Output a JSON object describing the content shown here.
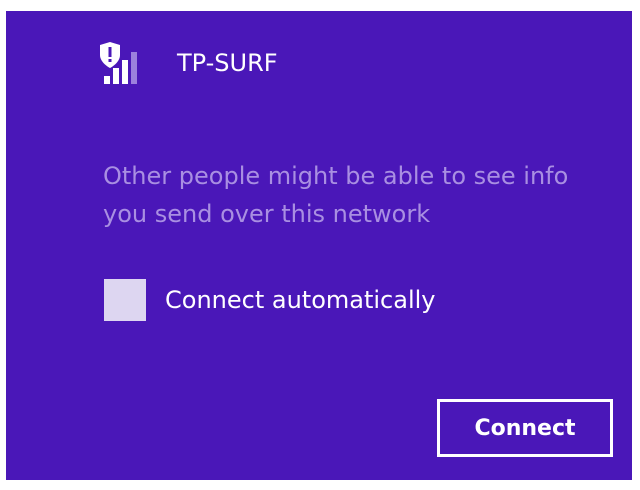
{
  "network": {
    "ssid": "TP-SURF",
    "icon": "wifi-signal-icon",
    "security_icon": "shield-warning-icon",
    "signal_bars_filled": 3,
    "signal_bars_total": 5
  },
  "warning": {
    "text": "Other people might be able to see info you send over this network"
  },
  "auto_connect": {
    "label": "Connect automatically",
    "checked": false
  },
  "actions": {
    "connect_label": "Connect"
  },
  "colors": {
    "background": "#4a17b8",
    "text": "#ffffff",
    "warning_text": "#a98fe2",
    "checkbox_fill": "#ddd6f1"
  }
}
